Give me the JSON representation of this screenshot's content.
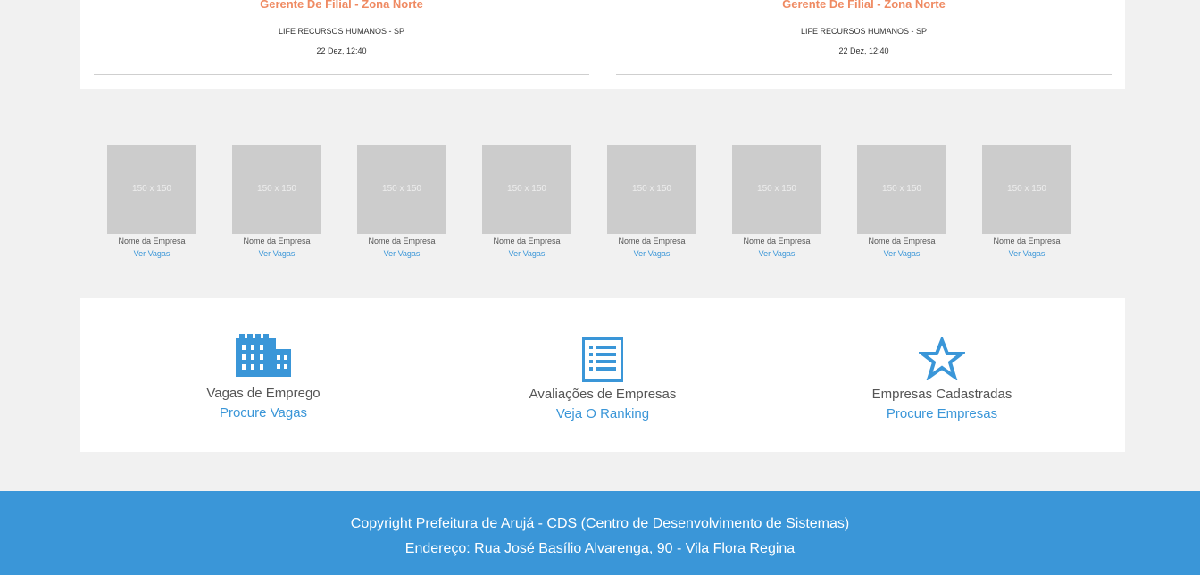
{
  "jobs": [
    {
      "title": "Gerente De Filial - Zona Norte",
      "company": "LIFE RECURSOS HUMANOS - SP",
      "date": "22 Dez, 12:40"
    },
    {
      "title": "Gerente De Filial - Zona Norte",
      "company": "LIFE RECURSOS HUMANOS - SP",
      "date": "22 Dez, 12:40"
    }
  ],
  "companies": {
    "placeholder": "150 x 150",
    "items": [
      {
        "name": "Nome da Empresa",
        "link": "Ver Vagas"
      },
      {
        "name": "Nome da Empresa",
        "link": "Ver Vagas"
      },
      {
        "name": "Nome da Empresa",
        "link": "Ver Vagas"
      },
      {
        "name": "Nome da Empresa",
        "link": "Ver Vagas"
      },
      {
        "name": "Nome da Empresa",
        "link": "Ver Vagas"
      },
      {
        "name": "Nome da Empresa",
        "link": "Ver Vagas"
      },
      {
        "name": "Nome da Empresa",
        "link": "Ver Vagas"
      },
      {
        "name": "Nome da Empresa",
        "link": "Ver Vagas"
      }
    ]
  },
  "features": [
    {
      "icon": "building-icon",
      "label": "Vagas de Emprego",
      "link": "Procure Vagas"
    },
    {
      "icon": "list-icon",
      "label": "Avaliações de Empresas",
      "link": "Veja O Ranking"
    },
    {
      "icon": "star-icon",
      "label": "Empresas Cadastradas",
      "link": "Procure Empresas"
    }
  ],
  "footer": {
    "copyright": "Copyright Prefeitura de Arujá - CDS (Centro de Desenvolvimento de Sistemas)",
    "address": "Endereço: Rua José Basílio Alvarenga, 90 - Vila Flora Regina"
  },
  "colors": {
    "accent": "#3a96d8",
    "job_title": "#ef8a62",
    "background": "#f1f1f1",
    "placeholder": "#cccccc"
  }
}
